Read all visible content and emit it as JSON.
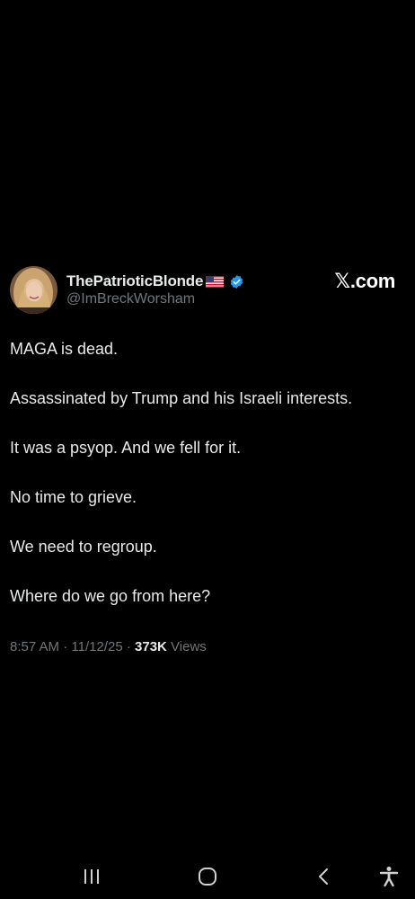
{
  "tweet": {
    "display_name": "ThePatrioticBlonde",
    "handle": "@ImBreckWorsham",
    "brand": "𝕏.com",
    "lines": [
      "MAGA is dead.",
      "Assassinated by Trump and his Israeli interests.",
      "It was a psyop. And we fell for it.",
      "No time to grieve.",
      "We need to regroup.",
      "Where do we go from here?"
    ],
    "meta": {
      "time": "8:57 AM",
      "sep1": " · ",
      "date": "11/12/25",
      "sep2": " · ",
      "views_count": "373K",
      "views_label": " Views"
    }
  },
  "icons": {
    "flag": "us-flag-icon",
    "verified": "verified-badge-icon",
    "nav": [
      "recent-apps-icon",
      "home-icon",
      "back-icon",
      "accessibility-icon"
    ]
  },
  "colors": {
    "background": "#000000",
    "text": "#e7e9ea",
    "secondary": "#71767b",
    "verified": "#1d9bf0"
  }
}
